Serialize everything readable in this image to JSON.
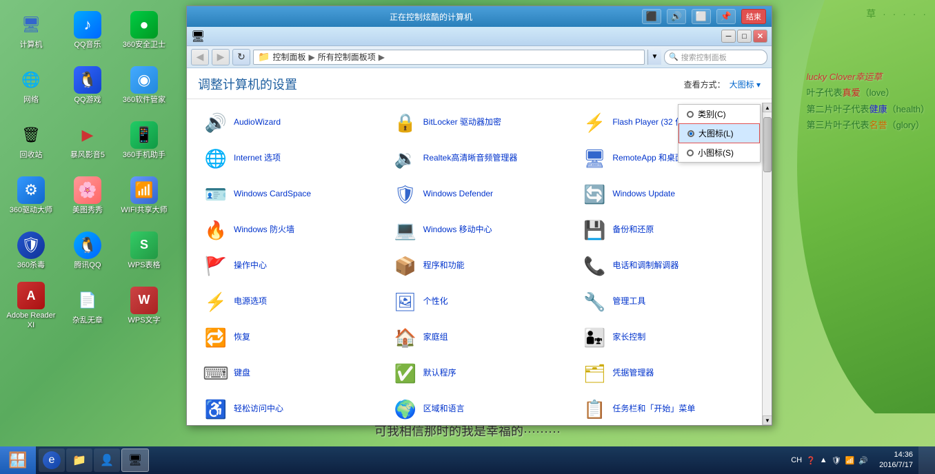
{
  "desktop": {
    "background_color": "#7bc47f"
  },
  "remote_titlebar": {
    "title": "正在控制炫酷的计算机",
    "end_label": "结束",
    "buttons": [
      "monitor",
      "speaker",
      "rectangle",
      "pin"
    ]
  },
  "window": {
    "nav": {
      "address": "控制面板 ▶ 所有控制面板项 ▶",
      "search_placeholder": "搜索控制面板"
    },
    "page_title": "调整计算机的设置",
    "view_label": "查看方式：",
    "view_mode": "大图标 ▾",
    "dropdown": {
      "items": [
        {
          "label": "类别(C)",
          "active": false
        },
        {
          "label": "大图标(L)",
          "active": true
        },
        {
          "label": "小图标(S)",
          "active": false
        }
      ]
    },
    "cp_items": [
      {
        "label": "AudioWizard",
        "icon": "🔊",
        "color": "ic-gray"
      },
      {
        "label": "BitLocker 驱动器加密",
        "icon": "🔒",
        "color": "ic-blue"
      },
      {
        "label": "Flash Player (32 位)",
        "icon": "⚡",
        "color": "ic-red"
      },
      {
        "label": "Internet 选项",
        "icon": "🌐",
        "color": "ic-blue"
      },
      {
        "label": "Realtek高清晰音频管理器",
        "icon": "🔉",
        "color": "ic-blue"
      },
      {
        "label": "RemoteApp 和桌面连接",
        "icon": "🖥",
        "color": "ic-blue"
      },
      {
        "label": "Windows CardSpace",
        "icon": "🪪",
        "color": "ic-blue"
      },
      {
        "label": "Windows Defender",
        "icon": "🛡",
        "color": "ic-blue"
      },
      {
        "label": "Windows Update",
        "icon": "🔄",
        "color": "ic-blue"
      },
      {
        "label": "Windows 防火墙",
        "icon": "🔥",
        "color": "ic-orange"
      },
      {
        "label": "Windows 移动中心",
        "icon": "💻",
        "color": "ic-blue"
      },
      {
        "label": "备份和还原",
        "icon": "💾",
        "color": "ic-blue"
      },
      {
        "label": "操作中心",
        "icon": "🚩",
        "color": "ic-blue"
      },
      {
        "label": "程序和功能",
        "icon": "📦",
        "color": "ic-blue"
      },
      {
        "label": "电话和调制解调器",
        "icon": "📞",
        "color": "ic-gray"
      },
      {
        "label": "电源选项",
        "icon": "⚡",
        "color": "ic-blue"
      },
      {
        "label": "个性化",
        "icon": "🖼",
        "color": "ic-blue"
      },
      {
        "label": "管理工具",
        "icon": "🔧",
        "color": "ic-gray"
      },
      {
        "label": "恢复",
        "icon": "🔁",
        "color": "ic-blue"
      },
      {
        "label": "家庭组",
        "icon": "🏠",
        "color": "ic-green"
      },
      {
        "label": "家长控制",
        "icon": "👨‍👧",
        "color": "ic-blue"
      },
      {
        "label": "键盘",
        "icon": "⌨",
        "color": "ic-gray"
      },
      {
        "label": "默认程序",
        "icon": "✅",
        "color": "ic-blue"
      },
      {
        "label": "凭据管理器",
        "icon": "🗂",
        "color": "ic-yellow"
      },
      {
        "label": "轻松访问中心",
        "icon": "♿",
        "color": "ic-blue"
      },
      {
        "label": "区域和语言",
        "icon": "🌍",
        "color": "ic-blue"
      },
      {
        "label": "任务栏和「开始」菜单",
        "icon": "📋",
        "color": "ic-blue"
      }
    ]
  },
  "taskbar": {
    "start_label": "开始",
    "tray_items": [
      "CH",
      "?",
      "↑",
      "🛡",
      "📶",
      "🔊"
    ],
    "clock": "14:36",
    "date": "2016/7/17"
  },
  "desktop_icons": [
    {
      "label": "计算机",
      "icon": "🖥",
      "col": 1,
      "row": 1
    },
    {
      "label": "QQ音乐",
      "icon": "♪",
      "col": 2,
      "row": 1
    },
    {
      "label": "360安全卫士",
      "icon": "●",
      "col": 3,
      "row": 1
    },
    {
      "label": "网络",
      "icon": "🌐",
      "col": 1,
      "row": 2
    },
    {
      "label": "QQ游戏",
      "icon": "🐧",
      "col": 2,
      "row": 2
    },
    {
      "label": "360软件管家",
      "icon": "◉",
      "col": 3,
      "row": 2
    },
    {
      "label": "回收站",
      "icon": "🗑",
      "col": 1,
      "row": 3
    },
    {
      "label": "暴风影音5",
      "icon": "▶",
      "col": 2,
      "row": 3
    },
    {
      "label": "360手机助手",
      "icon": "📱",
      "col": 3,
      "row": 3
    },
    {
      "label": "360驱动大师",
      "icon": "⚙",
      "col": 1,
      "row": 4
    },
    {
      "label": "美图秀秀",
      "icon": "🌸",
      "col": 2,
      "row": 4
    },
    {
      "label": "WIFI共享大师",
      "icon": "📶",
      "col": 3,
      "row": 4
    },
    {
      "label": "360杀毒",
      "icon": "🛡",
      "col": 1,
      "row": 5
    },
    {
      "label": "腾讯QQ",
      "icon": "🐧",
      "col": 2,
      "row": 5
    },
    {
      "label": "WPS表格",
      "icon": "S",
      "col": 3,
      "row": 5
    },
    {
      "label": "Adobe Reader XI",
      "icon": "A",
      "col": 1,
      "row": 6
    },
    {
      "label": "杂乱无章",
      "icon": "📄",
      "col": 2,
      "row": 6
    },
    {
      "label": "WPS文字",
      "icon": "W",
      "col": 3,
      "row": 6
    }
  ],
  "right_side": {
    "dots": "草 · · · · ·",
    "clover_text": "lucky Clover幸运草",
    "line1": "叶子代表",
    "love": "真爱",
    "love_en": "（love）",
    "line2": "第二片叶子代表",
    "health": "健康",
    "health_en": "（health）",
    "line3": "第三片叶子代表",
    "glory": "名誉",
    "glory_en": "（glory）"
  },
  "bottom_text": "可我相信那时的我是幸福的·········"
}
